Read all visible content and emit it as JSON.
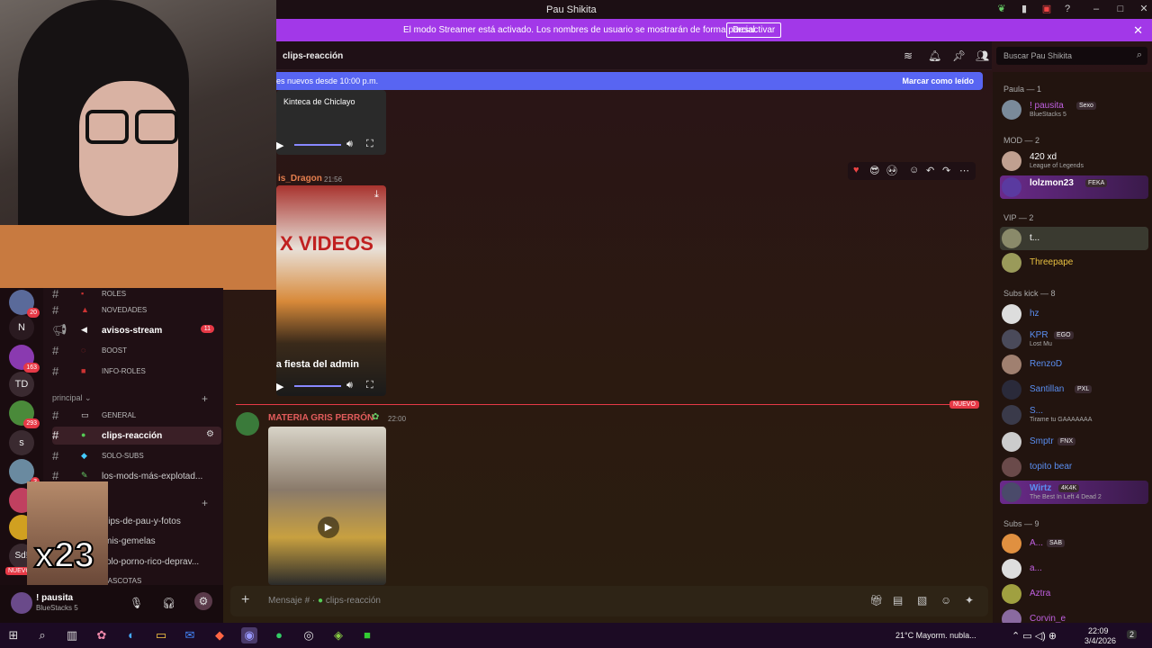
{
  "window": {
    "title": "Pau Shikita"
  },
  "streamer_banner": {
    "message": "El modo Streamer está activado. Los nombres de usuario se mostrarán de forma parcial.",
    "button": "Desactivar"
  },
  "channel_header": {
    "name": "clips-reacción",
    "search_placeholder": "Buscar Pau Shikita"
  },
  "new_messages_bar": {
    "text": "es nuevos desde 10:00 p.m.",
    "action": "Marcar como leído"
  },
  "servers": [
    {
      "label": "",
      "badge": "20"
    },
    {
      "label": "N",
      "badge": ""
    },
    {
      "label": "",
      "badge": "163"
    },
    {
      "label": "TD",
      "badge": ""
    },
    {
      "label": "",
      "badge": "293"
    },
    {
      "label": "s",
      "badge": ""
    },
    {
      "label": "",
      "badge": "3"
    },
    {
      "label": "",
      "badge": "1"
    },
    {
      "label": "",
      "badge": ""
    },
    {
      "label": "Sd!",
      "badge": ""
    }
  ],
  "rail_new_label": "NUEVO",
  "channels": [
    {
      "label": "roles",
      "unread": ""
    },
    {
      "label": "novedades",
      "unread": ""
    },
    {
      "label": "avisos-stream",
      "unread": "11"
    },
    {
      "label": "boost",
      "unread": ""
    },
    {
      "label": "info-roles",
      "unread": ""
    }
  ],
  "category": "principal",
  "channels2": [
    {
      "label": "general"
    },
    {
      "label": "clips-reacción"
    },
    {
      "label": "solo-subs"
    },
    {
      "label": "los-mods-más-explotad..."
    },
    {
      "label": "lips-de-pau-y-fotos"
    },
    {
      "label": "mis-gemelas"
    },
    {
      "label": "solo-porno-rico-deprav..."
    },
    {
      "label": "mascotas"
    }
  ],
  "user_panel": {
    "name": "! pausita",
    "status": "BlueStacks 5"
  },
  "webcam_overlay": {
    "text": "x23"
  },
  "messages": {
    "msg1_caption": "Kinteca de Chiclayo",
    "msg2_author": "is_Dragon",
    "msg2_time": "21:56",
    "msg2_video_text_top": "X VIDEOS",
    "msg2_video_text_bottom": "La fiesta del admin",
    "new_divider_label": "NUEVO",
    "msg3_author": "MATERIA GRIS PERRÓN",
    "msg3_time": "22:00"
  },
  "composer": {
    "placeholder": "Mensaje # · ",
    "channel": "clips-reacción"
  },
  "members": {
    "groups": [
      {
        "title": "Paula — 1"
      },
      {
        "title": "MOD — 2"
      },
      {
        "title": "VIP — 2"
      },
      {
        "title": "Subs kick — 8"
      },
      {
        "title": "Subs — 9"
      }
    ],
    "list": [
      {
        "name": "! pausita",
        "status": "BlueStacks 5",
        "tag": "Sexo",
        "color": "#c060e0"
      },
      {
        "name": "420 xd",
        "status": "League of Legends",
        "tag": "",
        "color": "#ffffff"
      },
      {
        "name": "lolzmon23",
        "status": "",
        "tag": "FEKA",
        "color": "#ffffff"
      },
      {
        "name": "t...",
        "status": "",
        "tag": "",
        "color": "#ffffff"
      },
      {
        "name": "Threepape",
        "status": "",
        "tag": "",
        "color": "#e8c040"
      },
      {
        "name": "hz",
        "status": "",
        "tag": "",
        "color": "#5a8ef0"
      },
      {
        "name": "KPR",
        "status": "Lost Mu",
        "tag": "EGO",
        "color": "#5a8ef0"
      },
      {
        "name": "RenzoD",
        "status": "",
        "tag": "",
        "color": "#5a8ef0"
      },
      {
        "name": "Santillan",
        "status": "",
        "tag": "PXL",
        "color": "#5a8ef0"
      },
      {
        "name": "S...",
        "status": "Tirame tu GAAAAAAA",
        "tag": "",
        "color": "#5a8ef0"
      },
      {
        "name": "Smptr",
        "status": "",
        "tag": "FNX",
        "color": "#5a8ef0"
      },
      {
        "name": "topito bear",
        "status": "",
        "tag": "",
        "color": "#5a8ef0"
      },
      {
        "name": "Wirtz",
        "status": "The Best In Left 4 Dead 2",
        "tag": "4K4K",
        "color": "#5a8ef0"
      },
      {
        "name": "A...",
        "status": "",
        "tag": "SAB",
        "color": "#c060e0"
      },
      {
        "name": "a...",
        "status": "",
        "tag": "",
        "color": "#c060e0"
      },
      {
        "name": "Aztra",
        "status": "",
        "tag": "",
        "color": "#c060e0"
      },
      {
        "name": "Corvin_e",
        "status": "",
        "tag": "",
        "color": "#c060e0"
      }
    ]
  },
  "taskbar": {
    "weather": "21°C  Mayorm. nubla...",
    "time": "22:09",
    "date": "3/4/2026",
    "notif": "2"
  }
}
